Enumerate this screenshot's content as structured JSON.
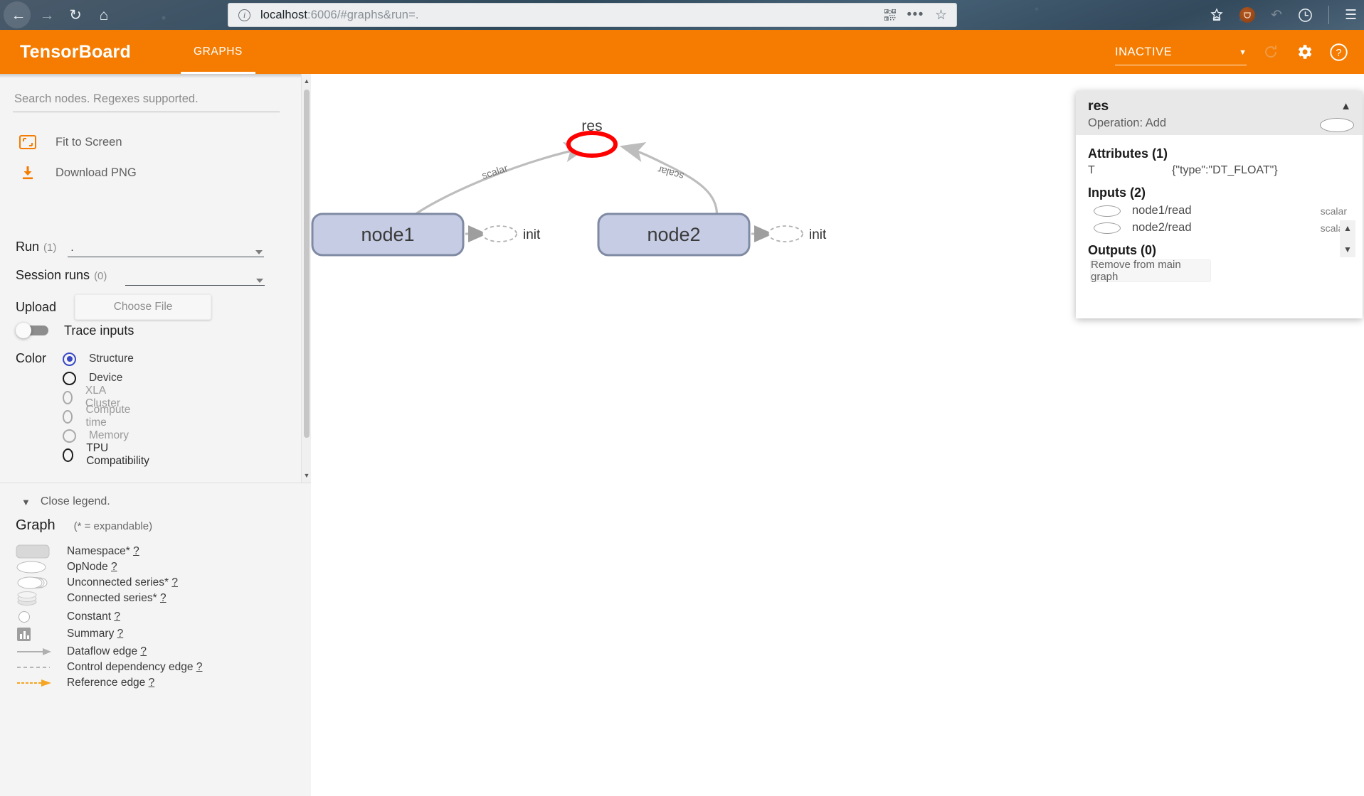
{
  "browser": {
    "url_prefix": "localhost",
    "url_suffix": ":6006/#graphs&run=.",
    "back_icon": "back-arrow-icon",
    "forward_icon": "forward-arrow-icon",
    "reload_icon": "reload-icon",
    "home_icon": "home-icon",
    "info_glyph": "i",
    "qr_icon": "qr-code-icon",
    "menu_dots": "•••",
    "star_glyph": "☆",
    "pocket_icon": "pocket-icon",
    "save_icon": "save-to-pocket-icon",
    "sync_icon": "sync-icon",
    "history_icon": "history-icon",
    "hamburger_icon": "☰"
  },
  "header": {
    "logo": "TensorBoard",
    "tabs": [
      {
        "label": "GRAPHS",
        "active": true
      }
    ],
    "run_state": "INACTIVE",
    "reload_icon": "reload-icon",
    "settings_icon": "gear-icon",
    "help_icon": "help-icon"
  },
  "sidebar": {
    "search_placeholder": "Search nodes. Regexes supported.",
    "fit_to_screen": "Fit to Screen",
    "download_png": "Download PNG",
    "run": {
      "label": "Run",
      "count": "(1)",
      "value": "."
    },
    "session_runs": {
      "label": "Session runs",
      "count": "(0)",
      "value": ""
    },
    "upload": {
      "label": "Upload",
      "button": "Choose File"
    },
    "trace_inputs": {
      "label": "Trace inputs",
      "on": false
    },
    "color": {
      "label": "Color",
      "options": [
        {
          "label": "Structure",
          "selected": true,
          "disabled": false
        },
        {
          "label": "Device",
          "selected": false,
          "disabled": false
        },
        {
          "label": "XLA Cluster",
          "selected": false,
          "disabled": true
        },
        {
          "label": "Compute time",
          "selected": false,
          "disabled": true
        },
        {
          "label": "Memory",
          "selected": false,
          "disabled": true
        },
        {
          "label": "TPU Compatibility",
          "selected": false,
          "disabled": false
        }
      ]
    }
  },
  "legend": {
    "close_label": "Close legend.",
    "title": "Graph",
    "expandable_note": "(* = expandable)",
    "items": [
      {
        "label": "Namespace*",
        "help": "?",
        "icon": "namespace-icon"
      },
      {
        "label": "OpNode",
        "help": "?",
        "icon": "opnode-icon"
      },
      {
        "label": "Unconnected series*",
        "help": "?",
        "icon": "unconnected-series-icon"
      },
      {
        "label": "Connected series*",
        "help": "?",
        "icon": "connected-series-icon"
      },
      {
        "label": "Constant",
        "help": "?",
        "icon": "constant-icon"
      },
      {
        "label": "Summary",
        "help": "?",
        "icon": "summary-icon"
      },
      {
        "label": "Dataflow edge",
        "help": "?",
        "icon": "dataflow-edge-icon"
      },
      {
        "label": "Control dependency edge",
        "help": "?",
        "icon": "control-dependency-edge-icon"
      },
      {
        "label": "Reference edge",
        "help": "?",
        "icon": "reference-edge-icon"
      }
    ]
  },
  "graph": {
    "nodes": [
      {
        "id": "res",
        "label": "res",
        "type": "opnode",
        "selected": true
      },
      {
        "id": "node1",
        "label": "node1",
        "type": "namespace",
        "selected": false
      },
      {
        "id": "node2",
        "label": "node2",
        "type": "namespace",
        "selected": false
      },
      {
        "id": "init1",
        "label": "init",
        "type": "dashed",
        "selected": false
      },
      {
        "id": "init2",
        "label": "init",
        "type": "dashed",
        "selected": false
      }
    ],
    "edges": [
      {
        "from": "node1",
        "to": "res",
        "label": "scalar",
        "style": "dataflow"
      },
      {
        "from": "node2",
        "to": "res",
        "label": "scalar",
        "style": "dataflow"
      },
      {
        "from": "node1",
        "to": "init1",
        "label": "",
        "style": "control"
      },
      {
        "from": "node2",
        "to": "init2",
        "label": "",
        "style": "control"
      }
    ],
    "ghost_labels": [
      "node1",
      "node2"
    ]
  },
  "info_panel": {
    "title": "res",
    "operation": "Operation: Add",
    "collapse_icon": "chevron-up-icon",
    "attributes": {
      "heading": "Attributes (1)",
      "rows": [
        {
          "key": "T",
          "value": "{\"type\":\"DT_FLOAT\"}"
        }
      ]
    },
    "inputs": {
      "heading": "Inputs (2)",
      "rows": [
        {
          "name": "node1/read",
          "meta": "scalar"
        },
        {
          "name": "node2/read",
          "meta": "scalar"
        }
      ]
    },
    "outputs": {
      "heading": "Outputs (0)",
      "rows": []
    },
    "remove_button": "Remove from main graph"
  },
  "colors": {
    "accent": "#f57c00",
    "selected_node": "#ff0000",
    "namespace_fill": "#c6cce4",
    "namespace_stroke": "#7f8aa3",
    "radio_selected": "#3949c4"
  }
}
